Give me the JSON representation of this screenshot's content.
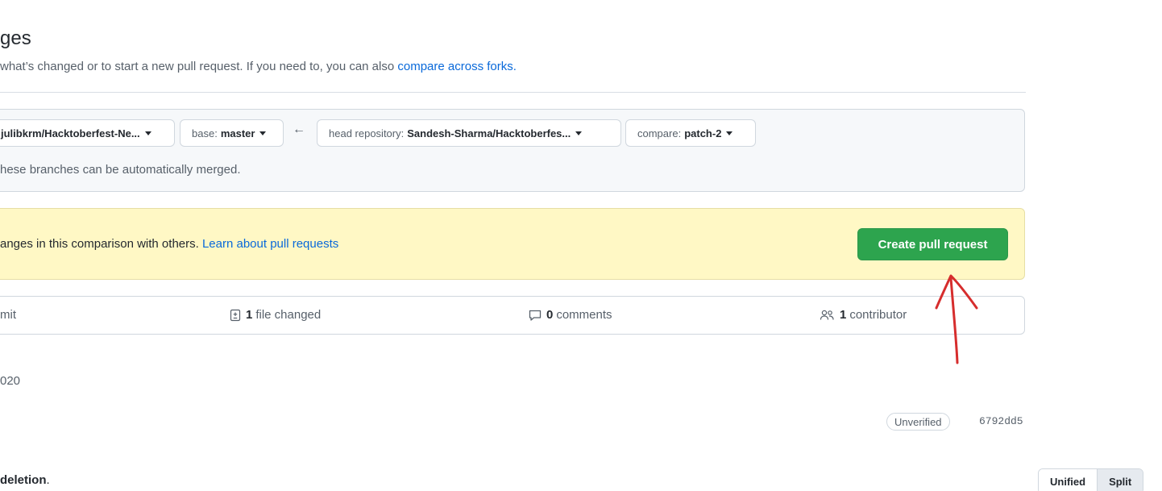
{
  "header": {
    "title": "ges",
    "subtitle_text": " what’s changed or to start a new pull request. If you need to, you can also ",
    "subtitle_link": "compare across forks."
  },
  "range_editor": {
    "base_repo_label": "julibkrm/Hacktoberfest-Ne...",
    "base_prefix": "base:",
    "base_branch": "master",
    "head_repo_prefix": "head repository:",
    "head_repo": "Sandesh-Sharma/Hacktoberfes...",
    "compare_prefix": "compare:",
    "compare_branch": "patch-2",
    "merge_status": "hese branches can be automatically merged."
  },
  "flash": {
    "text": "anges in this comparison with others. ",
    "link": "Learn about pull requests",
    "button": "Create pull request"
  },
  "stats": {
    "commits_label": "mit",
    "files_count": "1",
    "files_label": "file changed",
    "comments_count": "0",
    "comments_label": "comments",
    "contributors_count": "1",
    "contributors_label": "contributor"
  },
  "commit": {
    "date_fragment": "020",
    "badge": "Unverified",
    "sha": "6792dd5"
  },
  "diff": {
    "summary_bold": "deletion",
    "summary_tail": ".",
    "unified_label": "Unified",
    "split_label": "Split"
  },
  "colors": {
    "primary_button": "#2da44e",
    "link": "#0969da",
    "flash_bg": "#fff8c5",
    "annotation": "#d62d2d"
  }
}
